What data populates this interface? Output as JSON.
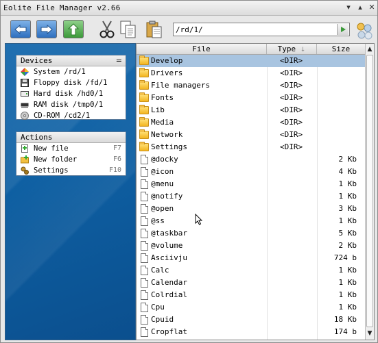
{
  "window": {
    "title": "Eolite File Manager v2.66",
    "minimize": "▾",
    "maximize": "▴",
    "close": "✕"
  },
  "toolbar": {
    "address_value": "/rd/1/",
    "buttons": [
      "back-icon",
      "forward-icon",
      "up-icon",
      "cut-icon",
      "copy-icon",
      "paste-icon",
      "go-icon",
      "home-icon"
    ]
  },
  "devices": {
    "title": "Devices",
    "menu": "=",
    "items": [
      {
        "label": "System /rd/1",
        "icon": "system-icon"
      },
      {
        "label": "Floppy disk /fd/1",
        "icon": "floppy-icon"
      },
      {
        "label": "Hard disk /hd0/1",
        "icon": "harddisk-icon"
      },
      {
        "label": "RAM disk /tmp0/1",
        "icon": "ramdisk-icon"
      },
      {
        "label": "CD-ROM /cd2/1",
        "icon": "cdrom-icon"
      }
    ]
  },
  "actions": {
    "title": "Actions",
    "items": [
      {
        "label": "New file",
        "key": "F7",
        "icon": "new-file-icon"
      },
      {
        "label": "New folder",
        "key": "F6",
        "icon": "new-folder-icon"
      },
      {
        "label": "Settings",
        "key": "F10",
        "icon": "settings-icon"
      }
    ]
  },
  "filelist": {
    "columns": {
      "file": "File",
      "type": "Type",
      "sort": "↓",
      "size": "Size"
    },
    "rows": [
      {
        "name": "Develop",
        "type": "<DIR>",
        "size": "",
        "kind": "folder",
        "selected": true
      },
      {
        "name": "Drivers",
        "type": "<DIR>",
        "size": "",
        "kind": "folder"
      },
      {
        "name": "File managers",
        "type": "<DIR>",
        "size": "",
        "kind": "folder"
      },
      {
        "name": "Fonts",
        "type": "<DIR>",
        "size": "",
        "kind": "folder"
      },
      {
        "name": "Lib",
        "type": "<DIR>",
        "size": "",
        "kind": "folder"
      },
      {
        "name": "Media",
        "type": "<DIR>",
        "size": "",
        "kind": "folder"
      },
      {
        "name": "Network",
        "type": "<DIR>",
        "size": "",
        "kind": "folder"
      },
      {
        "name": "Settings",
        "type": "<DIR>",
        "size": "",
        "kind": "folder"
      },
      {
        "name": "@docky",
        "type": "",
        "size": "2 Kb",
        "kind": "file"
      },
      {
        "name": "@icon",
        "type": "",
        "size": "4 Kb",
        "kind": "file"
      },
      {
        "name": "@menu",
        "type": "",
        "size": "1 Kb",
        "kind": "file"
      },
      {
        "name": "@notify",
        "type": "",
        "size": "1 Kb",
        "kind": "file"
      },
      {
        "name": "@open",
        "type": "",
        "size": "3 Kb",
        "kind": "file"
      },
      {
        "name": "@ss",
        "type": "",
        "size": "1 Kb",
        "kind": "file"
      },
      {
        "name": "@taskbar",
        "type": "",
        "size": "5 Kb",
        "kind": "file"
      },
      {
        "name": "@volume",
        "type": "",
        "size": "2 Kb",
        "kind": "file"
      },
      {
        "name": "Asciivju",
        "type": "",
        "size": "724 b",
        "kind": "file"
      },
      {
        "name": "Calc",
        "type": "",
        "size": "1 Kb",
        "kind": "file"
      },
      {
        "name": "Calendar",
        "type": "",
        "size": "1 Kb",
        "kind": "file"
      },
      {
        "name": "Colrdial",
        "type": "",
        "size": "1 Kb",
        "kind": "file"
      },
      {
        "name": "Cpu",
        "type": "",
        "size": "1 Kb",
        "kind": "file"
      },
      {
        "name": "Cpuid",
        "type": "",
        "size": "18 Kb",
        "kind": "file"
      },
      {
        "name": "Cropflat",
        "type": "",
        "size": "174 b",
        "kind": "file"
      }
    ]
  },
  "scrollbar": {
    "up": "▲",
    "down": "▼"
  }
}
